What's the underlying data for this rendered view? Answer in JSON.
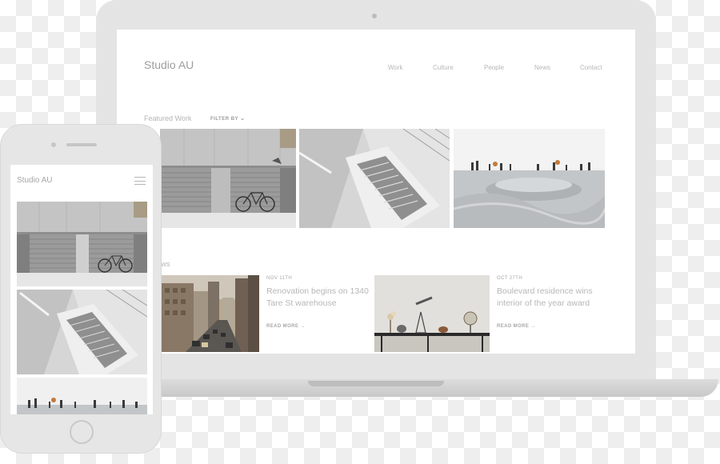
{
  "laptop": {
    "brand": "Studio AU",
    "nav": [
      {
        "label": "Work"
      },
      {
        "label": "Culture"
      },
      {
        "label": "People"
      },
      {
        "label": "News"
      },
      {
        "label": "Contact"
      }
    ],
    "featured": {
      "label": "Featured Work",
      "filter_label": "FILTER BY",
      "filter_icon": "chevron-down-icon",
      "images": [
        {
          "name": "bicycle-garage-photo"
        },
        {
          "name": "staircase-photo"
        },
        {
          "name": "skatepark-photo"
        }
      ]
    },
    "news": {
      "label": "nt News",
      "items": [
        {
          "date": "NOV 11TH",
          "title": "Renovation begins on 1340 Tare St warehouse",
          "read_more": "READ MORE",
          "image": "city-street-photo"
        },
        {
          "date": "OCT 27TH",
          "title": "Boulevard residence wins interior of the year award",
          "read_more": "READ MORE",
          "image": "shelf-decor-photo"
        }
      ]
    }
  },
  "phone": {
    "brand": "Studio AU",
    "menu_icon": "hamburger-menu-icon",
    "images": [
      {
        "name": "bicycle-garage-photo"
      },
      {
        "name": "staircase-photo"
      },
      {
        "name": "skatepark-photo"
      }
    ]
  },
  "colors": {
    "text_muted": "#b7b7b7",
    "device_frame": "#e4e4e4"
  }
}
